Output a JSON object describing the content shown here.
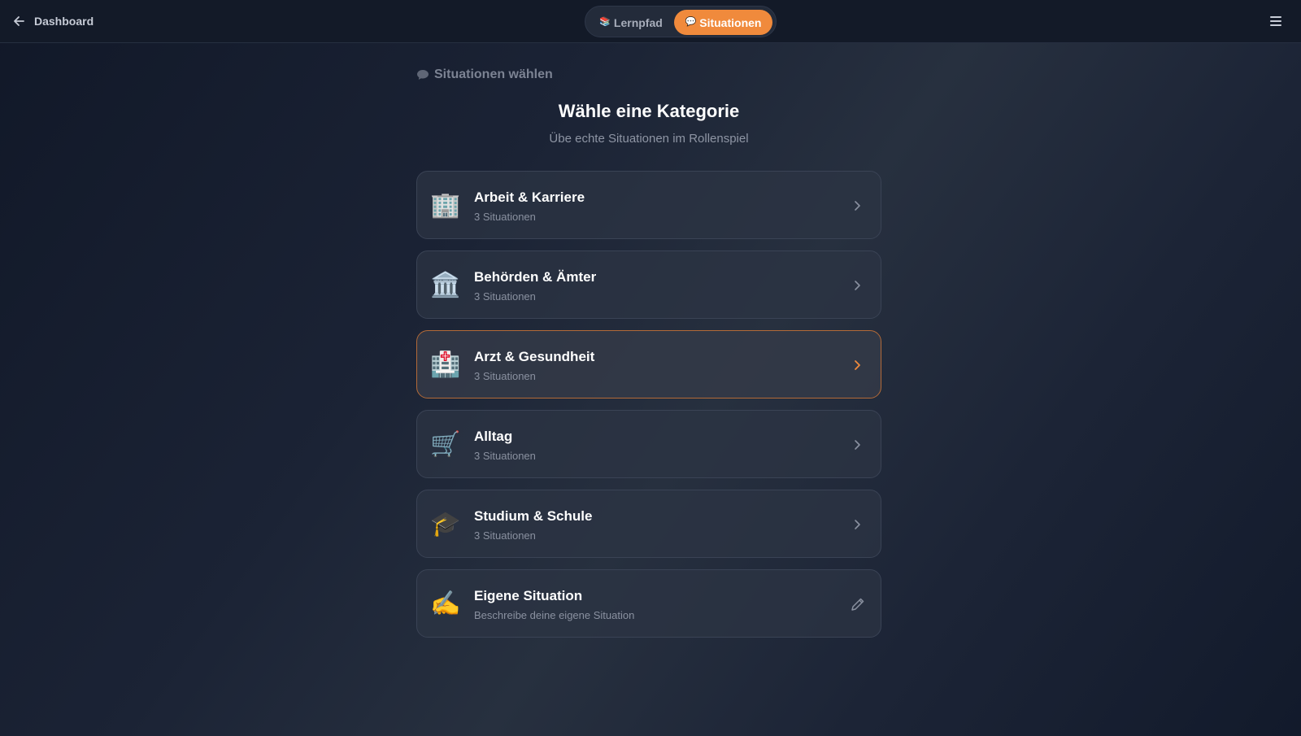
{
  "header": {
    "back_label": "Dashboard",
    "tabs": [
      {
        "label": "Lernpfad",
        "icon": "books-icon",
        "active": false
      },
      {
        "label": "Situationen",
        "icon": "speech-bubble-icon",
        "active": true
      }
    ],
    "menu_icon": "hamburger-menu-icon"
  },
  "main": {
    "breadcrumb": "Situationen wählen",
    "title": "Wähle eine Kategorie",
    "subtitle": "Übe echte Situationen im Rollenspiel",
    "categories": [
      {
        "icon": "🏢",
        "title": "Arbeit & Karriere",
        "subtitle": "3 Situationen",
        "action_icon": "chevron-right-icon"
      },
      {
        "icon": "🏛️",
        "title": "Behörden & Ämter",
        "subtitle": "3 Situationen",
        "action_icon": "chevron-right-icon"
      },
      {
        "icon": "🏥",
        "title": "Arzt & Gesundheit",
        "subtitle": "3 Situationen",
        "action_icon": "chevron-right-icon",
        "highlighted": true
      },
      {
        "icon": "🛒",
        "title": "Alltag",
        "subtitle": "3 Situationen",
        "action_icon": "chevron-right-icon"
      },
      {
        "icon": "🎓",
        "title": "Studium & Schule",
        "subtitle": "3 Situationen",
        "action_icon": "chevron-right-icon"
      },
      {
        "icon": "✍️",
        "title": "Eigene Situation",
        "subtitle": "Beschreibe deine eigene Situation",
        "action_icon": "pencil-icon"
      }
    ]
  },
  "colors": {
    "accent": "#f08a3c",
    "background": "#1b2335",
    "card": "#2c3444"
  }
}
